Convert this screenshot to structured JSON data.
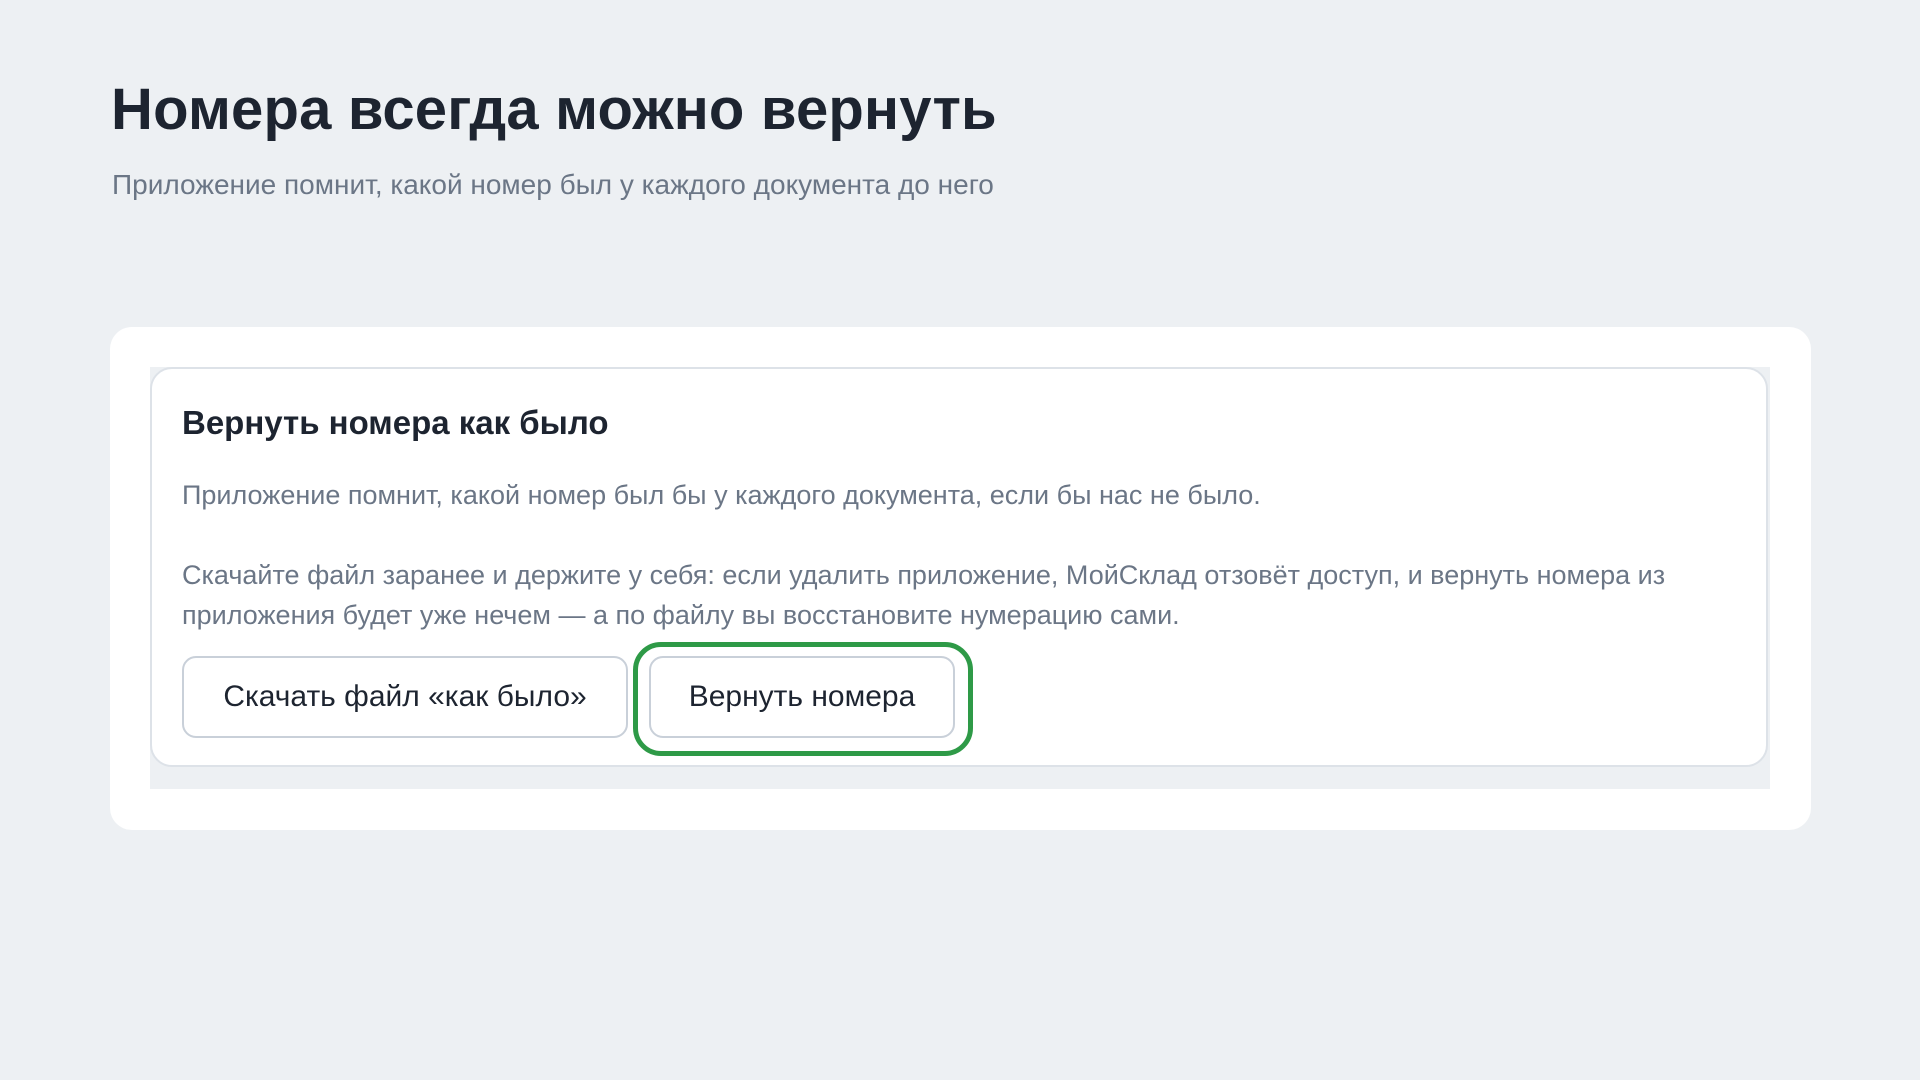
{
  "header": {
    "title": "Номера всегда можно вернуть",
    "subtitle": "Приложение помнит, какой номер был у каждого документа до него"
  },
  "restore_section": {
    "title": "Вернуть номера как было",
    "description": "Приложение помнит, какой номер был бы у каждого документа, если бы нас не было.",
    "note": "Скачайте файл заранее и держите у себя: если удалить приложение, МойСклад отзовёт доступ, и вернуть номера из приложения будет уже нечем — а по файлу вы восстановите нумерацию сами.",
    "download_button_label": "Скачать файл «как было»",
    "restore_button_label": "Вернуть номера"
  },
  "colors": {
    "background": "#edf0f3",
    "card": "#ffffff",
    "title_text": "#1d2430",
    "muted_text": "#6b7686",
    "highlight": "#2e9a47"
  }
}
